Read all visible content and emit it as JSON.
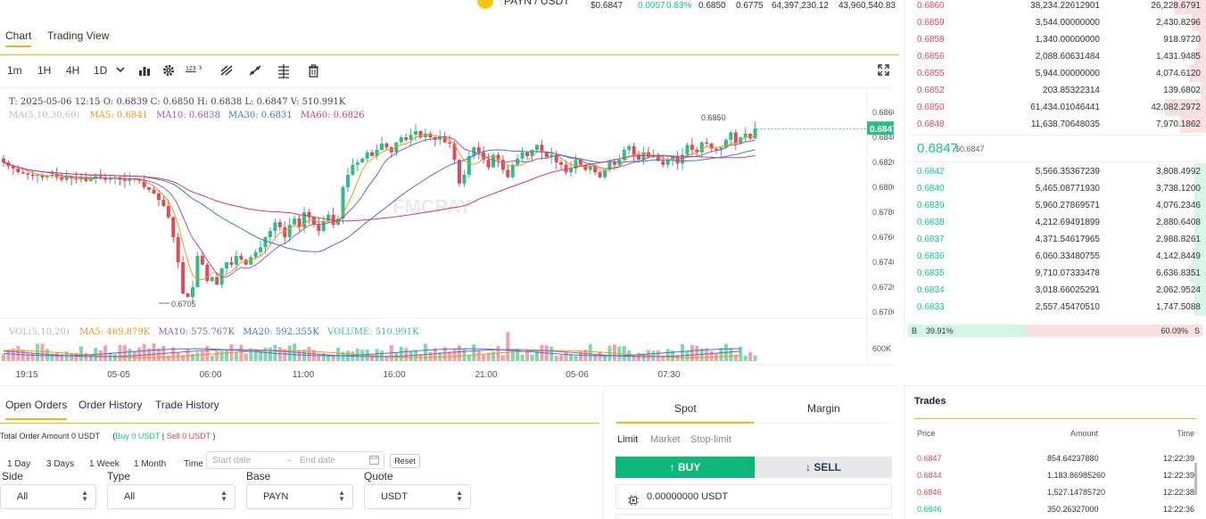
{
  "ticker": {
    "pair": "PAYN / USDT",
    "price": "$0.6847",
    "change": "0.0057",
    "change_pct": "0.83%",
    "high": "0.6850",
    "low": "0.6775",
    "vol1": "64,397,230.12",
    "vol2": "43,960,540.83"
  },
  "chart_tabs": [
    "Chart",
    "Trading View"
  ],
  "toolbar": {
    "intervals": [
      "1m",
      "1H",
      "4H",
      "1D"
    ],
    "indicator_label": "123"
  },
  "ohlc": {
    "line1": "T: 2025-05-06 12:15     O: 0.6839     C: 0.6850     H: 0.6838     L: 0.6847     V: 510.991K",
    "ma_label": "MA(5,10,30,60)",
    "ma5": "MA5: 0.6841",
    "ma10": "MA10: 0.6838",
    "ma30": "MA30: 0.6831",
    "ma60": "MA60: 0.6826"
  },
  "volume_legend": {
    "label": "VOL(5,10,20)",
    "ma5": "MA5: 469.879K",
    "ma10": "MA10: 575.767K",
    "ma20": "MA20: 592.355K",
    "volume": "VOLUME: 510.991K"
  },
  "watermark": "FMCPAY",
  "chart_data": {
    "type": "line",
    "title": "",
    "price_axis": [
      "0.6860",
      "0.6840",
      "0.6820",
      "0.6800",
      "0.6780",
      "0.6760",
      "0.6740",
      "0.6720",
      "0.6700"
    ],
    "volume_axis": [
      "600K"
    ],
    "time_axis": [
      "19:15",
      "05-05",
      "06:00",
      "11:00",
      "16:00",
      "21:00",
      "05-06",
      "07:30"
    ],
    "last_price": "0.6847",
    "high_mark": "0.6850",
    "low_mark": "0.6705",
    "ylim": [
      0.6695,
      0.6865
    ],
    "series": [
      {
        "name": "MA5",
        "color": "#f7931a"
      },
      {
        "name": "MA10",
        "color": "#9b59b6"
      },
      {
        "name": "MA30",
        "color": "#3a7bd5"
      },
      {
        "name": "MA60",
        "color": "#d63a6a"
      }
    ],
    "close": [
      0.682,
      0.6817,
      0.6815,
      0.6812,
      0.6811,
      0.681,
      0.6809,
      0.681,
      0.6808,
      0.6809,
      0.681,
      0.6808,
      0.6806,
      0.6809,
      0.6807,
      0.6806,
      0.6808,
      0.6805,
      0.6807,
      0.6809,
      0.6808,
      0.6806,
      0.6807,
      0.6808,
      0.6806,
      0.6805,
      0.6807,
      0.6806,
      0.6805,
      0.68,
      0.6798,
      0.6795,
      0.679,
      0.6785,
      0.6776,
      0.676,
      0.674,
      0.6715,
      0.6712,
      0.672,
      0.6745,
      0.6738,
      0.6725,
      0.6728,
      0.6722,
      0.6735,
      0.674,
      0.6738,
      0.6745,
      0.6742,
      0.6738,
      0.6744,
      0.6748,
      0.6752,
      0.676,
      0.6765,
      0.6772,
      0.6768,
      0.676,
      0.677,
      0.6775,
      0.6768,
      0.678,
      0.6776,
      0.677,
      0.6765,
      0.6773,
      0.6778,
      0.677,
      0.6775,
      0.68,
      0.681,
      0.6818,
      0.682,
      0.6823,
      0.6828,
      0.6825,
      0.683,
      0.6835,
      0.6832,
      0.6828,
      0.6836,
      0.684,
      0.6838,
      0.6842,
      0.6845,
      0.684,
      0.6843,
      0.684,
      0.6838,
      0.6841,
      0.6836,
      0.6835,
      0.6822,
      0.6803,
      0.681,
      0.6825,
      0.6832,
      0.6828,
      0.6822,
      0.6816,
      0.6826,
      0.6822,
      0.6814,
      0.6808,
      0.6818,
      0.6823,
      0.6828,
      0.6825,
      0.683,
      0.6834,
      0.6828,
      0.6824,
      0.6826,
      0.682,
      0.6818,
      0.6812,
      0.6815,
      0.6822,
      0.6818,
      0.6814,
      0.6817,
      0.6812,
      0.6808,
      0.6814,
      0.682,
      0.6818,
      0.6822,
      0.683,
      0.6833,
      0.6826,
      0.6822,
      0.6828,
      0.6824,
      0.6826,
      0.6821,
      0.6818,
      0.6822,
      0.6825,
      0.6819,
      0.6826,
      0.6834,
      0.683,
      0.6828,
      0.6836,
      0.6835,
      0.6831,
      0.683,
      0.6832,
      0.6838,
      0.6844,
      0.6835,
      0.684,
      0.6843,
      0.6839,
      0.6847
    ]
  },
  "orders": {
    "tabs": [
      "Open Orders",
      "Order History",
      "Trade History"
    ],
    "total_label": "Total Order Amount 0 USDT",
    "buy_label": "Buy 0 USDT",
    "sell_label": "Sell 0 USDT",
    "periods": [
      "1 Day",
      "3 Days",
      "1 Week",
      "1 Month"
    ],
    "time_label": "Time",
    "start_placeholder": "Start date",
    "end_placeholder": "End date",
    "reset": "Reset",
    "filters": [
      {
        "label": "Side",
        "value": "All"
      },
      {
        "label": "Type",
        "value": "All"
      },
      {
        "label": "Base",
        "value": "PAYN"
      },
      {
        "label": "Quote",
        "value": "USDT"
      }
    ]
  },
  "trade_form": {
    "tabs": [
      "Spot",
      "Margin"
    ],
    "order_types": [
      "Limit",
      "Market",
      "Stop-limit"
    ],
    "buy": "BUY",
    "sell": "SELL",
    "balance": "0.00000000 USDT"
  },
  "order_book": {
    "asks": [
      {
        "price": "0.6860",
        "amount": "38,234.22612901",
        "total": "26,228.6791",
        "depth": 0.11
      },
      {
        "price": "0.6859",
        "amount": "3,544.00000000",
        "total": "2,430.8296",
        "depth": 0.05
      },
      {
        "price": "0.6858",
        "amount": "1,340.00000000",
        "total": "918.9720",
        "depth": 0.03
      },
      {
        "price": "0.6856",
        "amount": "2,088.60631484",
        "total": "1,431.9485",
        "depth": 0.04
      },
      {
        "price": "0.6855",
        "amount": "5,944.00000000",
        "total": "4,074.6120",
        "depth": 0.06
      },
      {
        "price": "0.6852",
        "amount": "203.85322314",
        "total": "139.6802",
        "depth": 0.02
      },
      {
        "price": "0.6850",
        "amount": "61,434.01046441",
        "total": "42,082.2972",
        "depth": 0.14
      },
      {
        "price": "0.6848",
        "amount": "11,638.70648035",
        "total": "7,970.1862",
        "depth": 0.09
      }
    ],
    "mid_price": "0.6847",
    "mid_usd": "$0.6847",
    "bids": [
      {
        "price": "0.6842",
        "amount": "5,566.35367239",
        "total": "3,808.4992",
        "depth": 0.04
      },
      {
        "price": "0.6840",
        "amount": "5,465.08771930",
        "total": "3,738.1200",
        "depth": 0.04
      },
      {
        "price": "0.6839",
        "amount": "5,960.27869571",
        "total": "4,076.2346",
        "depth": 0.04
      },
      {
        "price": "0.6838",
        "amount": "4,212.69491899",
        "total": "2,880.6408",
        "depth": 0.04
      },
      {
        "price": "0.6837",
        "amount": "4,371.54617965",
        "total": "2,988.8261",
        "depth": 0.04
      },
      {
        "price": "0.6836",
        "amount": "6,060.33480755",
        "total": "4,142.8449",
        "depth": 0.05
      },
      {
        "price": "0.6835",
        "amount": "9,710.07333478",
        "total": "6,636.8351",
        "depth": 0.06
      },
      {
        "price": "0.6834",
        "amount": "3,018.66025291",
        "total": "2,062.9524",
        "depth": 0.04
      },
      {
        "price": "0.6833",
        "amount": "2,557.45470510",
        "total": "1,747.5088",
        "depth": 0.04
      }
    ],
    "buy_ratio_label": "B",
    "buy_ratio": "39.91%",
    "sell_ratio": "60.09%",
    "sell_ratio_label": "S",
    "buy_fraction": 0.3991
  },
  "trades": {
    "title": "Trades",
    "headers": [
      "Price",
      "Amount",
      "Time"
    ],
    "rows": [
      {
        "price": "0.6847",
        "amount": "854.64237880",
        "time": "12:22:39",
        "side": "sell"
      },
      {
        "price": "0.6844",
        "amount": "1,183.86985260",
        "time": "12:22:39",
        "side": "sell"
      },
      {
        "price": "0.6846",
        "amount": "1,527.14785720",
        "time": "12:22:38",
        "side": "sell"
      },
      {
        "price": "0.6846",
        "amount": "350.26327000",
        "time": "12:22:36",
        "side": "buy"
      }
    ]
  }
}
